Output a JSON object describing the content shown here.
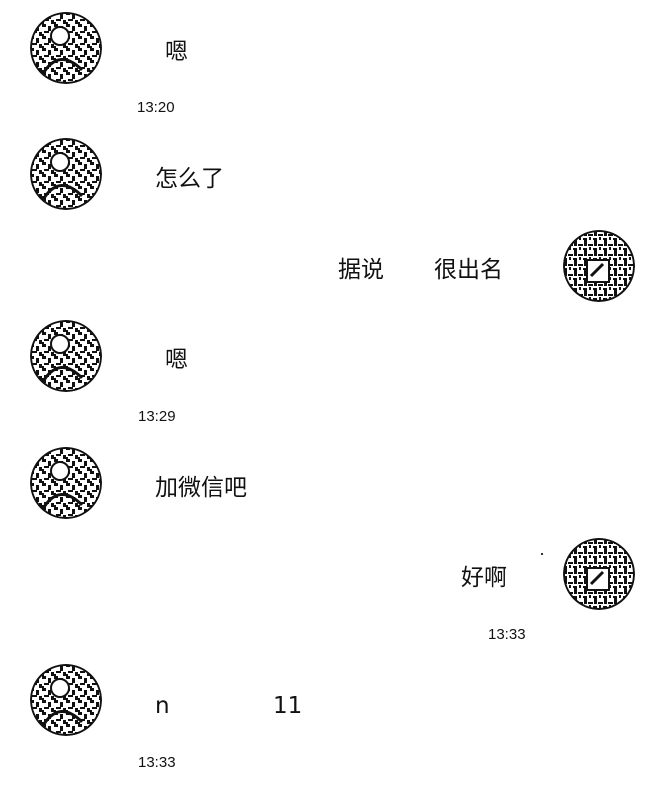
{
  "chat": {
    "messages": [
      {
        "side": "left",
        "text": "嗯",
        "time": "13:20"
      },
      {
        "side": "left",
        "text": "怎么了",
        "time": ""
      },
      {
        "side": "right",
        "text_a": "据说",
        "text_b": "很出名",
        "time": ""
      },
      {
        "side": "left",
        "text": "嗯",
        "time": "13:29"
      },
      {
        "side": "left",
        "text": "加微信吧",
        "time": ""
      },
      {
        "side": "right",
        "text": "好啊",
        "time": "13:33"
      },
      {
        "side": "left",
        "text_a": "n",
        "text_b": "11",
        "time": "13:33"
      }
    ],
    "avatars": {
      "left_icon": "user-avatar-icon",
      "right_icon": "self-avatar-icon"
    }
  }
}
